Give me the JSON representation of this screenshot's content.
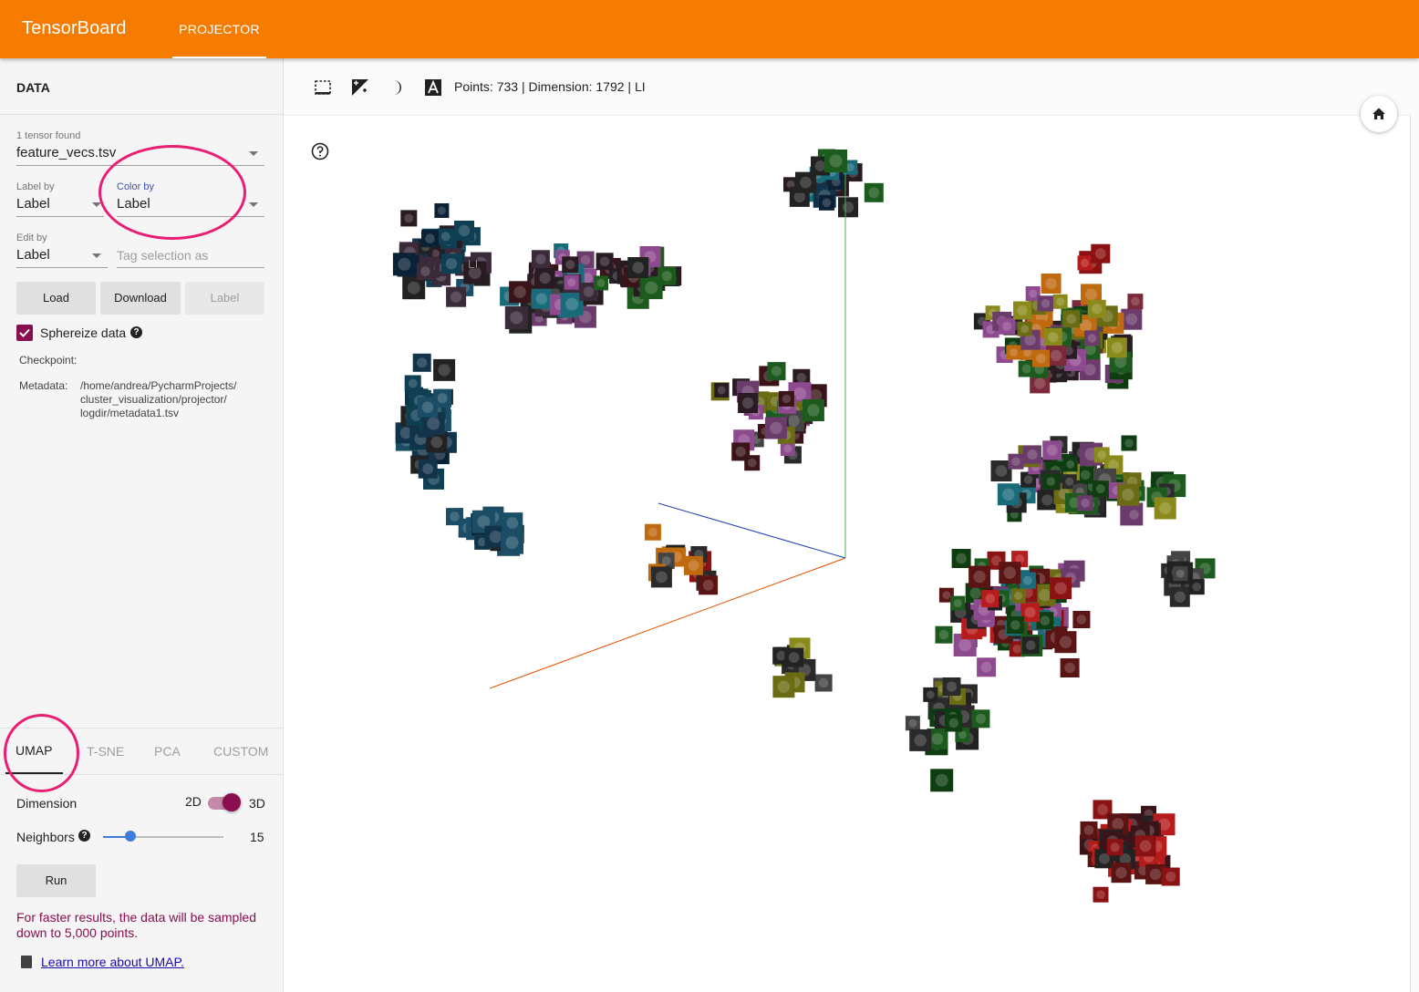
{
  "app": {
    "brand": "TensorBoard",
    "active_tab": "PROJECTOR"
  },
  "data_panel": {
    "header": "DATA",
    "tensor_count": "1 tensor found",
    "tensor_file": "feature_vecs.tsv",
    "label_by": {
      "label": "Label by",
      "value": "Label"
    },
    "color_by": {
      "label": "Color by",
      "value": "Label"
    },
    "edit_by": {
      "label": "Edit by",
      "value": "Label"
    },
    "tag_placeholder": "Tag selection as",
    "buttons": {
      "load": "Load",
      "download": "Download",
      "label": "Label"
    },
    "sphereize": {
      "label": "Sphereize data",
      "checked": true
    },
    "checkpoint_label": "Checkpoint:",
    "metadata_label": "Metadata:",
    "metadata_path_lines": [
      "/home/andrea/PycharmProjects/",
      "cluster_visualization/projector/",
      "logdir/metadata1.tsv"
    ]
  },
  "projection": {
    "tabs": [
      "UMAP",
      "T-SNE",
      "PCA",
      "CUSTOM"
    ],
    "active": "UMAP",
    "dimension": {
      "label": "Dimension",
      "left": "2D",
      "right": "3D",
      "value": "3D"
    },
    "neighbors": {
      "label": "Neighbors",
      "value": "15",
      "level_fraction": 0.2
    },
    "run_label": "Run",
    "notice": "For faster results, the data will be sampled down to 5,000 points.",
    "learn_more": "Learn more about UMAP."
  },
  "toolbar": {
    "status": "Points: 733 | Dimension: 1792 | LI",
    "icons": [
      "select-rectangle-icon",
      "night-mode-icon",
      "moon-icon",
      "label-icon"
    ]
  },
  "viz": {
    "hover_label": "LI",
    "palette": [
      "#0b2236",
      "#12344a",
      "#1b4e66",
      "#0f3f52",
      "#2a1a22",
      "#3a1418",
      "#5a1414",
      "#8b1212",
      "#b71c1c",
      "#4a3a4a",
      "#6b3b6b",
      "#8e4a8e",
      "#1d5a1d",
      "#0f3d12",
      "#6b6b14",
      "#8a8a1c",
      "#c06a10",
      "#2a2a2a",
      "#444444",
      "#1a6b7a",
      "#3a2a3a",
      "#222222",
      "#7a2a3a"
    ],
    "colors": {
      "axis_x": "#e65100",
      "axis_y": "#4caf50",
      "axis_z": "#1e40b0"
    }
  }
}
